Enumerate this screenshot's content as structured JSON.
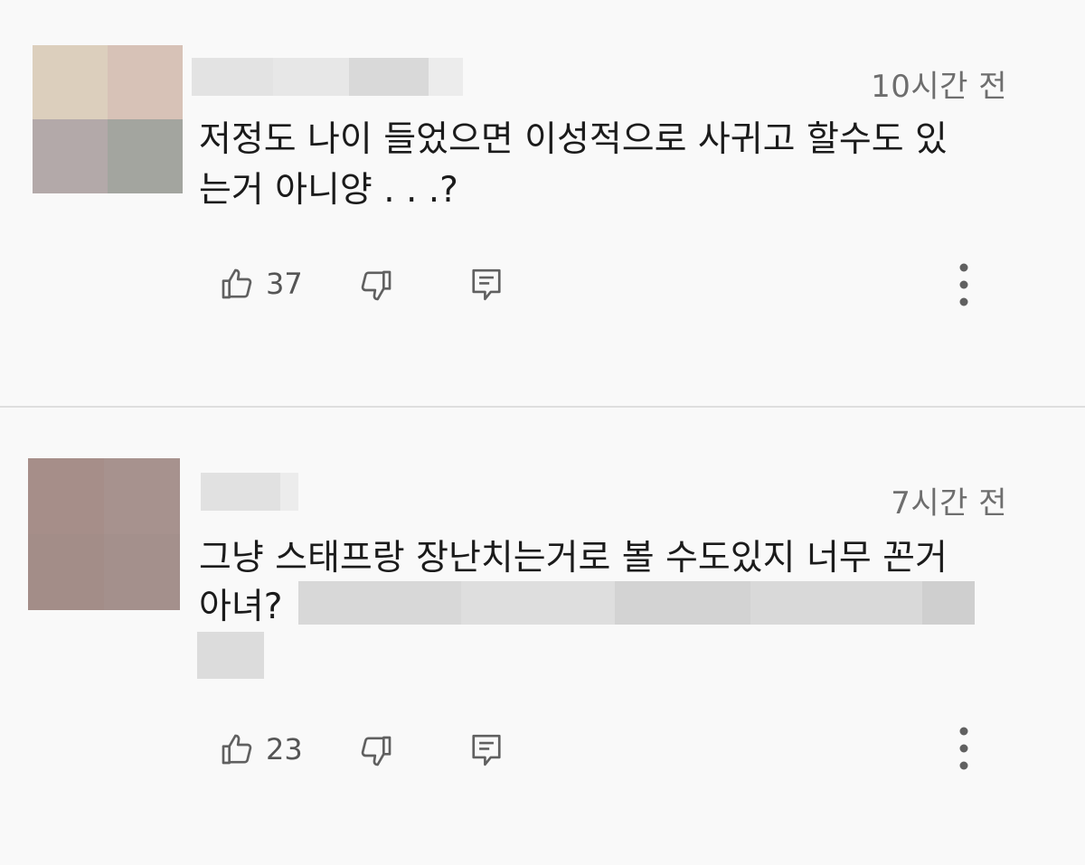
{
  "comments": [
    {
      "time": "10시간 전",
      "text_lines": [
        "저정도 나이 들었으면 이성적으로 사귀고 할수도 있",
        "는거 아니양 . . .?"
      ],
      "like_count": "37",
      "icons": [
        "thumb-up-icon",
        "thumb-down-icon",
        "reply-icon",
        "more-vert-icon"
      ]
    },
    {
      "time": "7시간 전",
      "text_lines": [
        "그냥 스태프랑 장난치는거로 볼 수도있지 너무 꼰거",
        "아녀?"
      ],
      "like_count": "23",
      "icons": [
        "thumb-up-icon",
        "thumb-down-icon",
        "reply-icon",
        "more-vert-icon"
      ]
    }
  ],
  "colors": {
    "background": "#f9f9f9",
    "divider": "#dedede",
    "icon": "#606060",
    "meta_text": "#6e6e6e",
    "blur": "#dcdcdc"
  }
}
